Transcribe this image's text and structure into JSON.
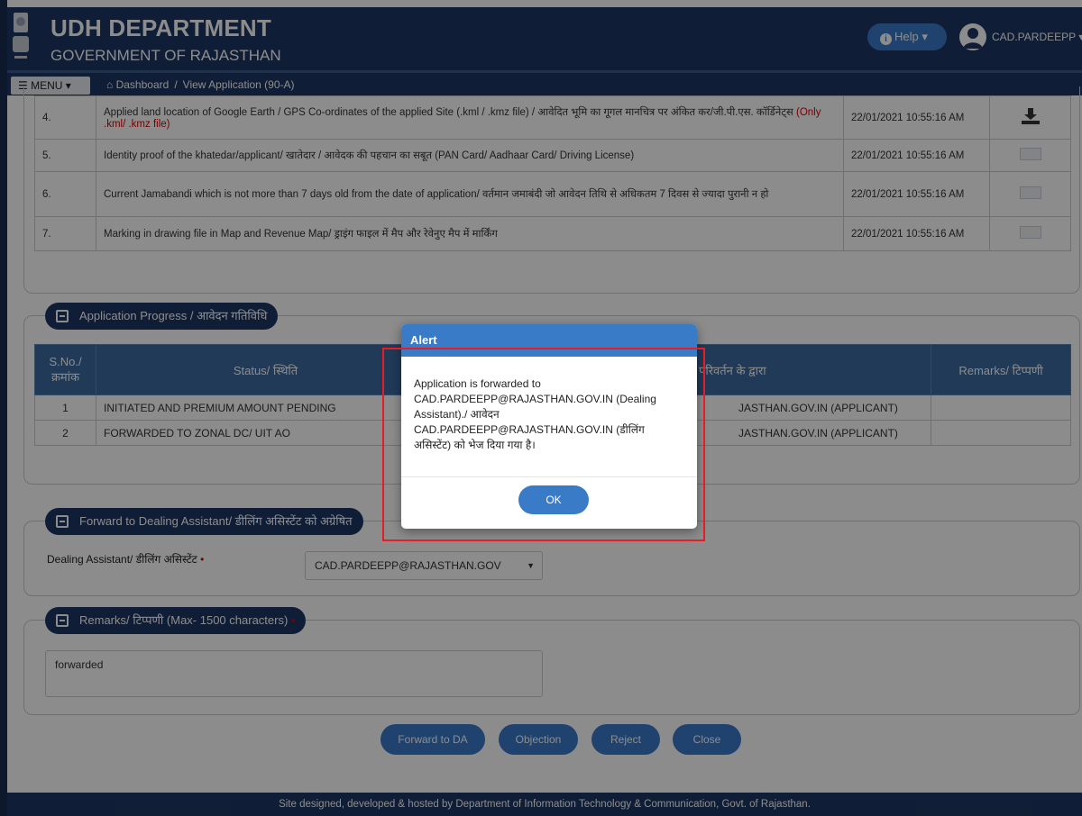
{
  "header": {
    "title": "UDH DEPARTMENT",
    "subtitle": "GOVERNMENT OF RAJASTHAN",
    "help_label": "Help",
    "user_name": "CAD.PARDEEPP"
  },
  "nav": {
    "menu_label": "MENU",
    "breadcrumb": [
      "Dashboard",
      "View Application (90-A)"
    ],
    "breadcrumb_sep": "/"
  },
  "documents": {
    "rows": [
      {
        "sno": "4.",
        "text": "Applied land location of Google Earth / GPS Co-ordinates of the applied Site (.kml / .kmz file) / आवेदित भूमि का गूगल मानचित्र पर अंकित कर/जी.पी.एस. कॉर्डिनेट्स",
        "note": "(Only .kml/ .kmz file)",
        "date": "22/01/2021 10:55:16 AM",
        "icon": "download-icon"
      },
      {
        "sno": "5.",
        "text": "Identity proof of the khatedar/applicant/ खातेदार / आवेदक की पहचान का सबूत (PAN Card/ Aadhaar Card/ Driving License)",
        "note": "",
        "date": "22/01/2021 10:55:16 AM",
        "icon": "image-thumb-icon"
      },
      {
        "sno": "6.",
        "text": "Current Jamabandi which is not more than 7 days old from the date of application/ वर्तमान जमाबंदी जो आवेदन तिथि से अधिकतम 7 दिवस से ज्यादा पुरानी न हो",
        "note": "",
        "date": "22/01/2021 10:55:16 AM",
        "icon": "image-thumb-icon"
      },
      {
        "sno": "7.",
        "text": "Marking in drawing file in Map and Revenue Map/ ड्राइंग फाइल में मैप और रेवेनुए मैप में मार्किंग",
        "note": "",
        "date": "22/01/2021 10:55:16 AM",
        "icon": "image-thumb-icon"
      }
    ]
  },
  "progress": {
    "legend": "Application Progress / आवेदन गतिविधि",
    "headers": [
      "S.No./ क्रमांक",
      "Status/ स्थिति",
      "Changed By/ स्थिति परिवर्तन के द्वारा",
      "Remarks/ टिप्पणी"
    ],
    "changed_by_visible": "anged By/ स्थिति परिवर्तन के द्वारा",
    "rows": [
      {
        "sno": "1",
        "status": "INITIATED AND PREMIUM AMOUNT PENDING",
        "changed_by": "JASTHAN.GOV.IN (APPLICANT)",
        "remarks": ""
      },
      {
        "sno": "2",
        "status": "FORWARDED TO ZONAL DC/ UIT AO",
        "changed_by": "JASTHAN.GOV.IN (APPLICANT)",
        "remarks": ""
      }
    ]
  },
  "forward": {
    "legend": "Forward to Dealing Assistant/ डीलिंग असिस्टेंट को अग्रेषित",
    "legend_visible": "Forward to Dealing Assistant/ डीलिंग असिस्टेंट को अ",
    "field_label": "Dealing Assistant/ डीलिंग असिस्टेंट",
    "required_mark": "•",
    "selected": "CAD.PARDEEPP@RAJASTHAN.GOV"
  },
  "remarks": {
    "legend": "Remarks/ टिप्पणी (Max- 1500 characters)",
    "required_mark": "•",
    "value": "forwarded"
  },
  "actions": {
    "forward": "Forward to DA",
    "objection": "Objection",
    "reject": "Reject",
    "close": "Close"
  },
  "footer": {
    "text": "Site designed, developed & hosted by Department of Information Technology & Communication, Govt. of Rajasthan."
  },
  "alert": {
    "title": "Alert",
    "message": "Application is forwarded to CAD.PARDEEPP@RAJASTHAN.GOV.IN (Dealing Assistant)./ आवेदन CAD.PARDEEPP@RAJASTHAN.GOV.IN (डीलिंग असिस्टेंट) को भेज दिया गया है।",
    "ok": "OK"
  },
  "colors": {
    "header_bg": "#1d3763",
    "accent": "#3a7bc8",
    "table_head": "#3b6ba0",
    "required": "#d00000",
    "highlight": "#e51e25"
  }
}
